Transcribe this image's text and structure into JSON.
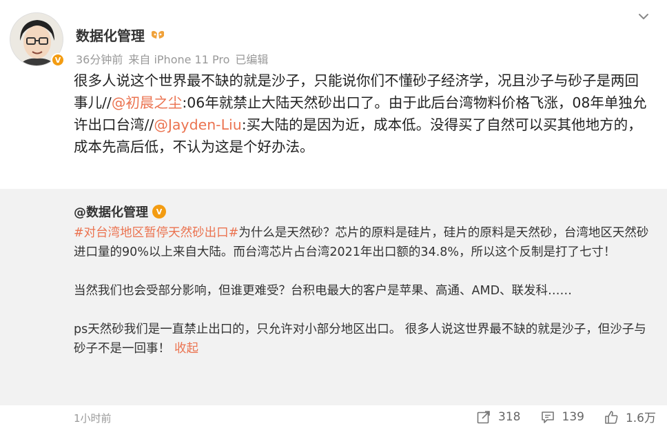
{
  "post": {
    "author": "数据化管理",
    "time": "36分钟前",
    "source": "来自 iPhone 11 Pro",
    "edited": "已编辑",
    "text_part1": "很多人说这个世界最不缺的就是沙子，只能说你们不懂砂子经济学，况且沙子与砂子是两回事儿//",
    "mention1": "@初晨之尘",
    "text_part2": ":06年就禁止大陆天然砂出口了。由于此后台湾物料价格飞涨，08年单独允许出口台湾//",
    "mention2": "@Jayden-Liu",
    "text_part3": ":买大陆的是因为近，成本低。没得买了自然可以买其他地方的，成本先高后低，不认为这是个好办法。"
  },
  "repost": {
    "author": "@数据化管理",
    "topic": "#对台湾地区暂停天然砂出口#",
    "p1_rest": "为什么是天然砂？芯片的原料是硅片，硅片的原料是天然砂，台湾地区天然砂进口量的90%以上来自大陆。而台湾芯片占台湾2021年出口额的34.8%，所以这个反制是打了七寸！",
    "p2": "当然我们也会受部分影响，但谁更难受？台积电最大的客户是苹果、高通、AMD、联发科……",
    "p3": "ps天然砂我们是一直禁止出口的，只允许对小部分地区出口。 很多人说这世界最不缺的就是沙子，但沙子与砂子不是一回事！",
    "collapse": "收起"
  },
  "footer": {
    "time": "1小时前",
    "repost_count": "318",
    "comment_count": "139",
    "like_count": "1.6万"
  },
  "colors": {
    "accent": "#eb7350",
    "badge": "#f39c12",
    "repost_bg": "#f2f2f2"
  },
  "icons": {
    "verified": "v-badge-icon",
    "member": "member-badge-icon",
    "more": "chevron-down-icon",
    "repost": "repost-icon",
    "comment": "comment-icon",
    "like": "thumbs-up-icon"
  }
}
